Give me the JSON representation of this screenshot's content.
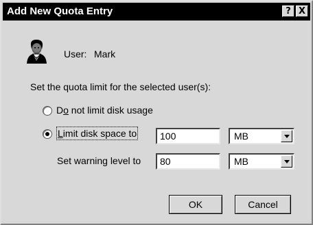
{
  "window": {
    "title": "Add New Quota Entry",
    "help_label": "?",
    "close_label": "X"
  },
  "user": {
    "label": "User:",
    "name": "Mark"
  },
  "instruction": "Set the quota limit for the selected user(s):",
  "options": {
    "no_limit": {
      "label_prefix": "D",
      "label_underline": "o",
      "label_rest": " not limit disk usage",
      "checked": false
    },
    "limit": {
      "label_underline": "L",
      "label_rest": "imit disk space to",
      "checked": true
    }
  },
  "limit": {
    "value": "100",
    "unit": "MB"
  },
  "warning": {
    "label": "Set warning level to",
    "value": "80",
    "unit": "MB"
  },
  "buttons": {
    "ok": "OK",
    "cancel": "Cancel"
  },
  "icons": {
    "user": "user-icon",
    "dropdown": "chevron-down-icon"
  }
}
